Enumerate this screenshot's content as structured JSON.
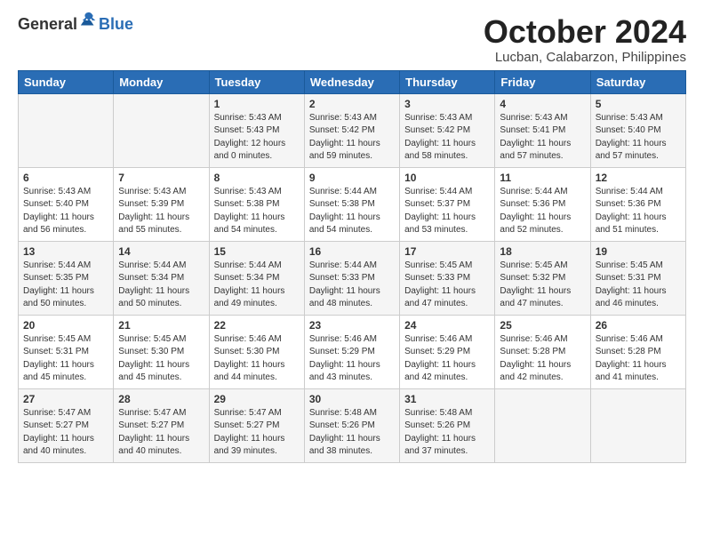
{
  "logo": {
    "general": "General",
    "blue": "Blue"
  },
  "title": "October 2024",
  "location": "Lucban, Calabarzon, Philippines",
  "days_header": [
    "Sunday",
    "Monday",
    "Tuesday",
    "Wednesday",
    "Thursday",
    "Friday",
    "Saturday"
  ],
  "weeks": [
    [
      {
        "day": "",
        "info": ""
      },
      {
        "day": "",
        "info": ""
      },
      {
        "day": "1",
        "info": "Sunrise: 5:43 AM\nSunset: 5:43 PM\nDaylight: 12 hours\nand 0 minutes."
      },
      {
        "day": "2",
        "info": "Sunrise: 5:43 AM\nSunset: 5:42 PM\nDaylight: 11 hours\nand 59 minutes."
      },
      {
        "day": "3",
        "info": "Sunrise: 5:43 AM\nSunset: 5:42 PM\nDaylight: 11 hours\nand 58 minutes."
      },
      {
        "day": "4",
        "info": "Sunrise: 5:43 AM\nSunset: 5:41 PM\nDaylight: 11 hours\nand 57 minutes."
      },
      {
        "day": "5",
        "info": "Sunrise: 5:43 AM\nSunset: 5:40 PM\nDaylight: 11 hours\nand 57 minutes."
      }
    ],
    [
      {
        "day": "6",
        "info": "Sunrise: 5:43 AM\nSunset: 5:40 PM\nDaylight: 11 hours\nand 56 minutes."
      },
      {
        "day": "7",
        "info": "Sunrise: 5:43 AM\nSunset: 5:39 PM\nDaylight: 11 hours\nand 55 minutes."
      },
      {
        "day": "8",
        "info": "Sunrise: 5:43 AM\nSunset: 5:38 PM\nDaylight: 11 hours\nand 54 minutes."
      },
      {
        "day": "9",
        "info": "Sunrise: 5:44 AM\nSunset: 5:38 PM\nDaylight: 11 hours\nand 54 minutes."
      },
      {
        "day": "10",
        "info": "Sunrise: 5:44 AM\nSunset: 5:37 PM\nDaylight: 11 hours\nand 53 minutes."
      },
      {
        "day": "11",
        "info": "Sunrise: 5:44 AM\nSunset: 5:36 PM\nDaylight: 11 hours\nand 52 minutes."
      },
      {
        "day": "12",
        "info": "Sunrise: 5:44 AM\nSunset: 5:36 PM\nDaylight: 11 hours\nand 51 minutes."
      }
    ],
    [
      {
        "day": "13",
        "info": "Sunrise: 5:44 AM\nSunset: 5:35 PM\nDaylight: 11 hours\nand 50 minutes."
      },
      {
        "day": "14",
        "info": "Sunrise: 5:44 AM\nSunset: 5:34 PM\nDaylight: 11 hours\nand 50 minutes."
      },
      {
        "day": "15",
        "info": "Sunrise: 5:44 AM\nSunset: 5:34 PM\nDaylight: 11 hours\nand 49 minutes."
      },
      {
        "day": "16",
        "info": "Sunrise: 5:44 AM\nSunset: 5:33 PM\nDaylight: 11 hours\nand 48 minutes."
      },
      {
        "day": "17",
        "info": "Sunrise: 5:45 AM\nSunset: 5:33 PM\nDaylight: 11 hours\nand 47 minutes."
      },
      {
        "day": "18",
        "info": "Sunrise: 5:45 AM\nSunset: 5:32 PM\nDaylight: 11 hours\nand 47 minutes."
      },
      {
        "day": "19",
        "info": "Sunrise: 5:45 AM\nSunset: 5:31 PM\nDaylight: 11 hours\nand 46 minutes."
      }
    ],
    [
      {
        "day": "20",
        "info": "Sunrise: 5:45 AM\nSunset: 5:31 PM\nDaylight: 11 hours\nand 45 minutes."
      },
      {
        "day": "21",
        "info": "Sunrise: 5:45 AM\nSunset: 5:30 PM\nDaylight: 11 hours\nand 45 minutes."
      },
      {
        "day": "22",
        "info": "Sunrise: 5:46 AM\nSunset: 5:30 PM\nDaylight: 11 hours\nand 44 minutes."
      },
      {
        "day": "23",
        "info": "Sunrise: 5:46 AM\nSunset: 5:29 PM\nDaylight: 11 hours\nand 43 minutes."
      },
      {
        "day": "24",
        "info": "Sunrise: 5:46 AM\nSunset: 5:29 PM\nDaylight: 11 hours\nand 42 minutes."
      },
      {
        "day": "25",
        "info": "Sunrise: 5:46 AM\nSunset: 5:28 PM\nDaylight: 11 hours\nand 42 minutes."
      },
      {
        "day": "26",
        "info": "Sunrise: 5:46 AM\nSunset: 5:28 PM\nDaylight: 11 hours\nand 41 minutes."
      }
    ],
    [
      {
        "day": "27",
        "info": "Sunrise: 5:47 AM\nSunset: 5:27 PM\nDaylight: 11 hours\nand 40 minutes."
      },
      {
        "day": "28",
        "info": "Sunrise: 5:47 AM\nSunset: 5:27 PM\nDaylight: 11 hours\nand 40 minutes."
      },
      {
        "day": "29",
        "info": "Sunrise: 5:47 AM\nSunset: 5:27 PM\nDaylight: 11 hours\nand 39 minutes."
      },
      {
        "day": "30",
        "info": "Sunrise: 5:48 AM\nSunset: 5:26 PM\nDaylight: 11 hours\nand 38 minutes."
      },
      {
        "day": "31",
        "info": "Sunrise: 5:48 AM\nSunset: 5:26 PM\nDaylight: 11 hours\nand 37 minutes."
      },
      {
        "day": "",
        "info": ""
      },
      {
        "day": "",
        "info": ""
      }
    ]
  ]
}
